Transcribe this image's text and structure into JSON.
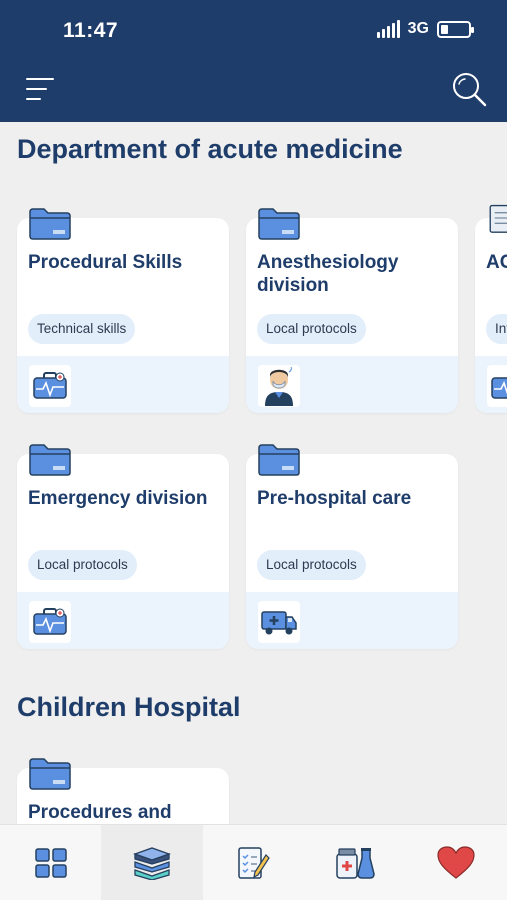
{
  "status_bar": {
    "time": "11:47",
    "network": "3G",
    "battery_level": 0.25
  },
  "header": {
    "menu_icon": "hamburger-menu-icon",
    "search_icon": "search-icon"
  },
  "sections": [
    {
      "title": "Department of acute medicine",
      "cards": [
        {
          "title": "Procedural Skills",
          "tag": "Technical skills",
          "icon": "medical-case-icon"
        },
        {
          "title": "Anesthesiology division",
          "tag": "Local protocols",
          "icon": "anesthesiologist-icon"
        },
        {
          "title": "AC",
          "tag": "Int",
          "icon": "medical-case-icon"
        },
        {
          "title": "Emergency division",
          "tag": "Local protocols",
          "icon": "medical-case-icon"
        },
        {
          "title": "Pre-hospital care",
          "tag": "Local protocols",
          "icon": "ambulance-icon"
        }
      ]
    },
    {
      "title": "Children Hospital",
      "cards": [
        {
          "title": "Procedures and",
          "icon": "folder-icon"
        }
      ]
    }
  ],
  "tabbar": {
    "tabs": [
      {
        "icon": "dashboard-grid-icon",
        "active": false
      },
      {
        "icon": "books-stack-icon",
        "active": true
      },
      {
        "icon": "checklist-pencil-icon",
        "active": false
      },
      {
        "icon": "medicine-bottles-icon",
        "active": false
      },
      {
        "icon": "heart-icon",
        "active": false
      }
    ]
  },
  "colors": {
    "header_bg": "#1f3d6a",
    "title_text": "#1f3d6a",
    "folder_blue": "#5b8fe0",
    "tag_bg": "#e3eefb",
    "card_footer_bg": "#ebf3fd",
    "heart_red": "#e04848"
  }
}
